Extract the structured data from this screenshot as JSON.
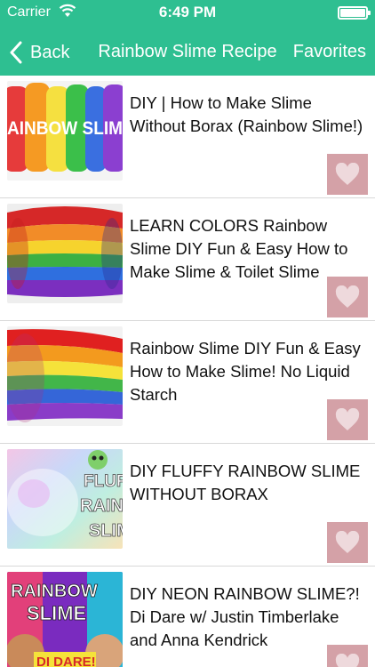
{
  "status_bar": {
    "carrier": "Carrier",
    "time": "6:49 PM",
    "icons": [
      "wifi-icon",
      "battery-icon"
    ]
  },
  "nav": {
    "back_label": "Back",
    "title": "Rainbow Slime Recipe",
    "favorites_label": "Favorites",
    "color": "#2ebf91"
  },
  "videos": [
    {
      "title": "DIY | How to Make Slime Without Borax (Rainbow Slime!)",
      "thumb_text": "AINBOW SLIM"
    },
    {
      "title": "LEARN COLORS Rainbow Slime DIY Fun & Easy How to Make Slime & Toilet Slime Surprise T…"
    },
    {
      "title": "Rainbow Slime DIY Fun & Easy How to Make Slime! No Liquid Starch"
    },
    {
      "title": "DIY FLUFFY RAINBOW SLIME WITHOUT BORAX",
      "thumb_text": [
        "FLUFF",
        "RAINB",
        "SLIM"
      ]
    },
    {
      "title": "DIY NEON RAINBOW SLIME?! Di Dare w/ Justin Timberlake and Anna Kendrick",
      "thumb_text": [
        "RAINBOW",
        "SLIME",
        "DI DARE!"
      ]
    }
  ],
  "favorite_button_color": "#d4a1a7"
}
